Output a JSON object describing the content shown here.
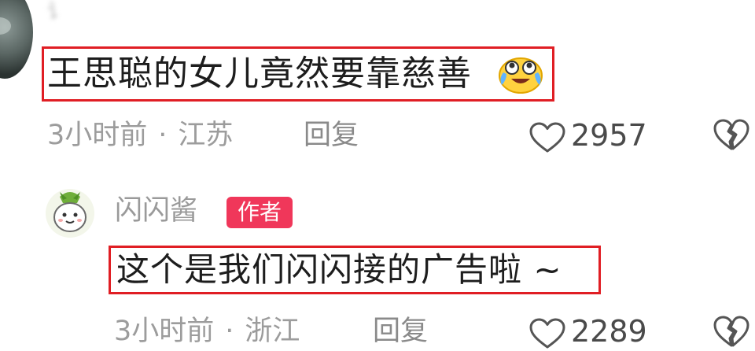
{
  "comments": [
    {
      "username": "讠",
      "text": "王思聪的女儿竟然要靠慈善",
      "emoji": "crying-laughing-emoji",
      "time": "3小时前",
      "separator": "·",
      "location": "江苏",
      "reply_label": "回复",
      "likes": "2957"
    },
    {
      "username": "闪闪酱",
      "badge": "作者",
      "text": "这个是我们闪闪接的广告啦 ~",
      "time": "3小时前",
      "separator": "·",
      "location": "浙江",
      "reply_label": "回复",
      "likes": "2289"
    }
  ],
  "colors": {
    "highlight_border": "#e01e24",
    "author_badge": "#f0375a",
    "meta_text": "#9c9c9c"
  }
}
